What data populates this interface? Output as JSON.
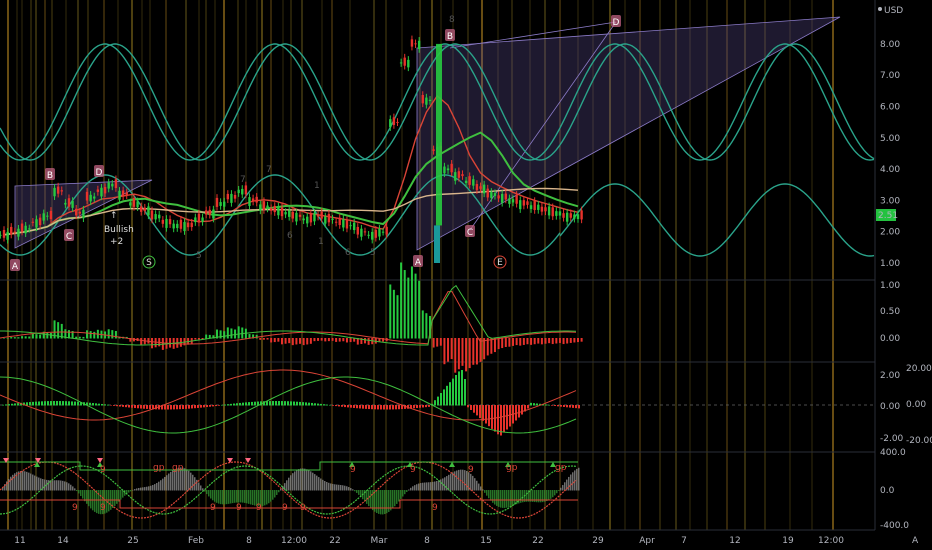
{
  "chart_data": {
    "type": "candlestick",
    "currency_label": "USD",
    "last_price_label": "2.51",
    "x_ticks": [
      "11",
      "14",
      "25",
      "Feb",
      "8",
      "12:00",
      "22",
      "Mar",
      "8",
      "15",
      "22",
      "29",
      "Apr",
      "7",
      "12",
      "19",
      "12:00"
    ],
    "y_axis_price": [
      "1.00",
      "2.00",
      "3.00",
      "4.00",
      "5.00",
      "6.00",
      "7.00",
      "8.00"
    ],
    "y_axis_osc1": [
      "1.00",
      "0.50",
      "0.00"
    ],
    "y_axis_osc2_left": [
      "2.00",
      "0.00",
      "-2.00"
    ],
    "y_axis_osc2_right": [
      "20.00",
      "0.00",
      "-20.00"
    ],
    "y_axis_osc3": [
      "400.0",
      "0.0",
      "-400.0"
    ],
    "price_series": [
      1.9,
      2.0,
      2.1,
      2.3,
      2.5,
      3.3,
      2.9,
      2.6,
      3.1,
      3.3,
      3.5,
      3.2,
      2.9,
      2.7,
      2.5,
      2.3,
      2.2,
      2.2,
      2.4,
      2.6,
      2.9,
      3.1,
      3.3,
      3.0,
      2.8,
      2.7,
      2.6,
      2.5,
      2.4,
      2.5,
      2.4,
      2.3,
      2.2,
      2.0,
      1.9,
      2.0,
      5.5,
      7.4,
      8.0,
      6.2,
      4.6,
      4.0,
      3.8,
      3.6,
      3.4,
      3.2,
      3.1,
      3.0,
      2.9,
      2.8,
      2.7,
      2.6,
      2.5,
      2.5
    ],
    "sine_wave_label": "",
    "patterns": [
      {
        "letter": "A",
        "kind": "pivot"
      },
      {
        "letter": "B",
        "kind": "pivot"
      },
      {
        "letter": "C",
        "kind": "pivot"
      },
      {
        "letter": "D",
        "kind": "pivot"
      },
      {
        "letter": "A",
        "kind": "pivot"
      },
      {
        "letter": "B",
        "kind": "pivot"
      },
      {
        "letter": "C",
        "kind": "pivot"
      },
      {
        "letter": "D",
        "kind": "pivot"
      },
      {
        "letter": "E",
        "kind": "pivot-circle"
      },
      {
        "letter": "S",
        "kind": "pivot-circle"
      }
    ],
    "annotations": {
      "bullish": "Bullish",
      "bullish_value": "+2",
      "nine": "9",
      "gp": "gp",
      "seven": "7",
      "six": "6",
      "five": "5",
      "one": "1",
      "eight": "8"
    },
    "colors": {
      "up": "#26c940",
      "down": "#e8322b",
      "sine": "#2aa38a",
      "ma_red": "#d94436",
      "ma_green": "#3fbf3f",
      "ma_tan": "#d9b58c",
      "triangle": "#6a5aa8",
      "last_price_bg": "#23c23f"
    }
  }
}
